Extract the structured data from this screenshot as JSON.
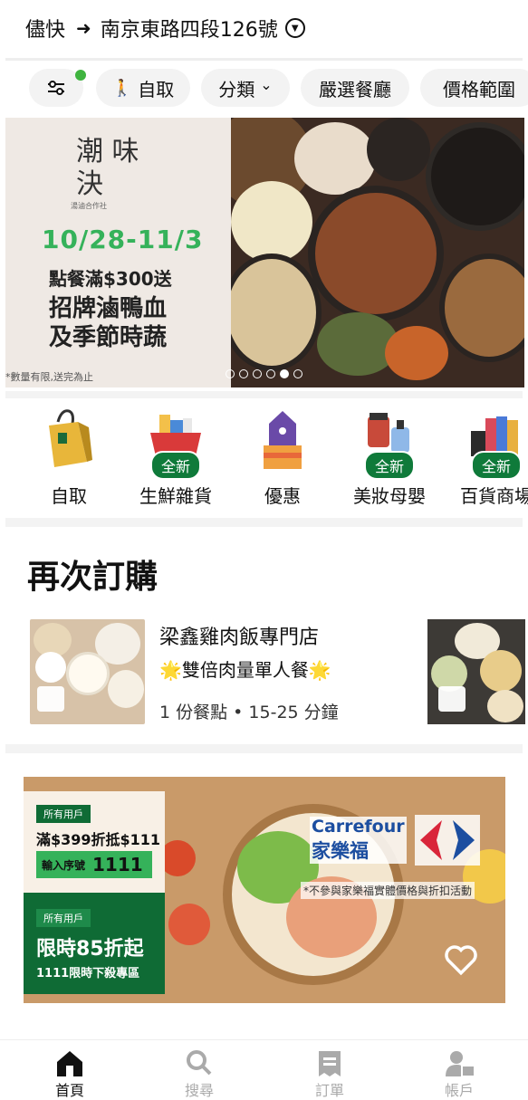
{
  "header": {
    "mode": "儘快",
    "arrow": "➜",
    "address": "南京東路四段126號"
  },
  "filters": {
    "chips": [
      "自取",
      "分類",
      "嚴選餐廳",
      "價格範圍"
    ],
    "category_chevron": "⌄"
  },
  "banner": {
    "brand": "潮味決",
    "brand_sub": "湯滷合作社",
    "date": "10/28-11/3",
    "line1": "點餐滿$300送",
    "line2": "招牌滷鴨血",
    "line3": "及季節時蔬",
    "note": "*數量有限,送完為止",
    "pages": 6,
    "active_page": 5
  },
  "categories": [
    {
      "label": "自取",
      "badge": ""
    },
    {
      "label": "生鮮雜貨",
      "badge": "全新"
    },
    {
      "label": "優惠",
      "badge": ""
    },
    {
      "label": "美妝母嬰",
      "badge": "全新"
    },
    {
      "label": "百貨商場",
      "badge": "全新"
    }
  ],
  "reorder": {
    "title": "再次訂購",
    "store_name": "梁鑫雞肉飯專門店",
    "promo": "🌟雙倍肉量單人餐🌟",
    "meta": "1 份餐點 • 15-25 分鐘"
  },
  "promo_card": {
    "tag1": "所有用戶",
    "offer1": "滿$399折抵$111",
    "code_label": "輸入序號",
    "code": "1111",
    "tag2": "所有用戶",
    "offer2": "限時85折起",
    "offer2_sub": "1111限時下殺專區",
    "brand_en": "Carrefour",
    "brand_zh": "家樂福",
    "note": "*不參與家樂福實體價格與折扣活動"
  },
  "tabbar": {
    "tabs": [
      "首頁",
      "搜尋",
      "訂單",
      "帳戶"
    ],
    "active": "首頁"
  },
  "colors": {
    "accent_green": "#35b25a",
    "dark_green": "#0f6b35",
    "indicator": "#3fb43f"
  }
}
